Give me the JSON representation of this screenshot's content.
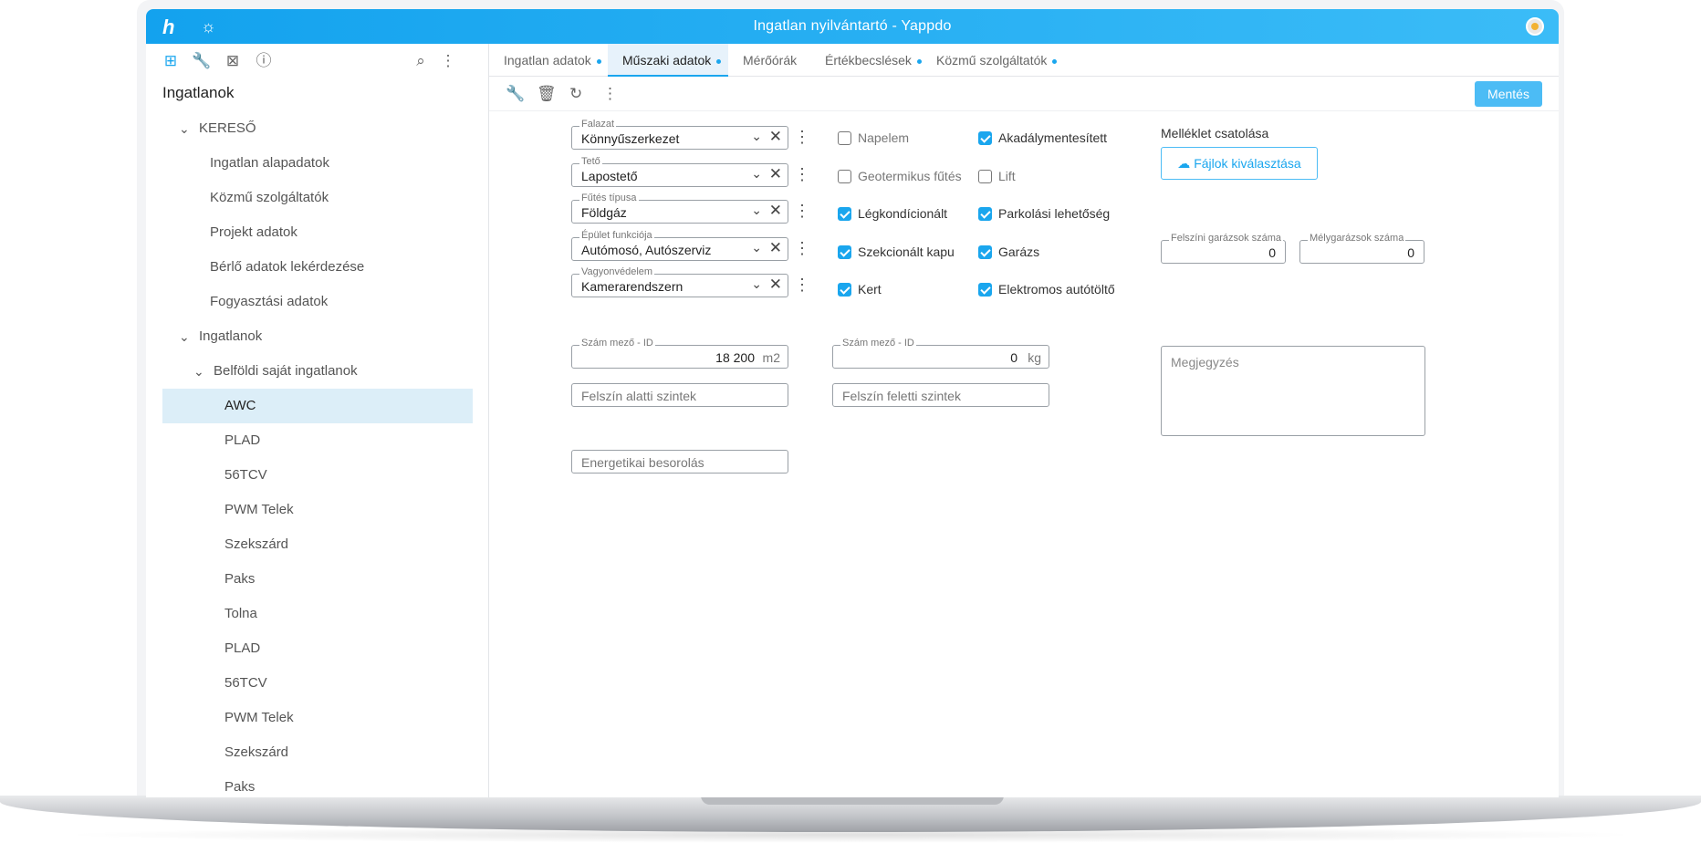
{
  "app": {
    "title": "Ingatlan nyilvántartó - Yappdo",
    "logo": "h"
  },
  "sidebar": {
    "title": "Ingatlanok",
    "tree": [
      {
        "label": "KERESŐ",
        "level": 1,
        "chev": "⌄"
      },
      {
        "label": "Ingatlan alapadatok",
        "level": 2
      },
      {
        "label": "Közmű szolgáltatók",
        "level": 2
      },
      {
        "label": "Projekt adatok",
        "level": 2
      },
      {
        "label": "Bérlő adatok lekérdezése",
        "level": 2
      },
      {
        "label": "Fogyasztási adatok",
        "level": 2
      },
      {
        "label": "Ingatlanok",
        "level": 1,
        "chev": "⌄"
      },
      {
        "label": "Belföldi saját ingatlanok",
        "level": 2,
        "chev": "⌄"
      },
      {
        "label": "AWC",
        "level": 3,
        "selected": true
      },
      {
        "label": "PLAD",
        "level": 3
      },
      {
        "label": "56TCV",
        "level": 3
      },
      {
        "label": "PWM Telek",
        "level": 3
      },
      {
        "label": "Szekszárd",
        "level": 3
      },
      {
        "label": "Paks",
        "level": 3
      },
      {
        "label": "Tolna",
        "level": 3
      },
      {
        "label": "PLAD",
        "level": 3
      },
      {
        "label": "56TCV",
        "level": 3
      },
      {
        "label": "PWM Telek",
        "level": 3
      },
      {
        "label": "Szekszárd",
        "level": 3
      },
      {
        "label": "Paks",
        "level": 3
      }
    ]
  },
  "tabs": [
    {
      "label": "Ingatlan adatok",
      "dot": true,
      "active": false
    },
    {
      "label": "Műszaki adatok",
      "dot": true,
      "active": true
    },
    {
      "label": "Mérőórák",
      "dot": false,
      "active": false
    },
    {
      "label": "Értékbecslések",
      "dot": true,
      "active": false
    },
    {
      "label": "Közmű szolgáltatók",
      "dot": true,
      "active": false
    }
  ],
  "toolbar": {
    "save_label": "Mentés"
  },
  "selects": [
    {
      "label": "Falazat",
      "value": "Könnyűszerkezet"
    },
    {
      "label": "Tető",
      "value": "Lapostető"
    },
    {
      "label": "Fűtés típusa",
      "value": "Földgáz"
    },
    {
      "label": "Épület funkciója",
      "value": "Autómosó, Autószerviz"
    },
    {
      "label": "Vagyonvédelem",
      "value": "Kamerarendszern"
    }
  ],
  "checkboxes_col1": [
    {
      "label": "Napelem",
      "checked": false
    },
    {
      "label": "Geotermikus fűtés",
      "checked": false
    },
    {
      "label": "Légkondícionált",
      "checked": true
    },
    {
      "label": "Szekcionált kapu",
      "checked": true
    },
    {
      "label": "Kert",
      "checked": true
    }
  ],
  "checkboxes_col2": [
    {
      "label": "Akadálymentesített",
      "checked": true
    },
    {
      "label": "Lift",
      "checked": false
    },
    {
      "label": "Parkolási lehetőség",
      "checked": true
    },
    {
      "label": "Garázs",
      "checked": true
    },
    {
      "label": "Elektromos autótöltő",
      "checked": true
    }
  ],
  "attachment": {
    "title": "Melléklet csatolása",
    "button": "Fájlok kiválasztása"
  },
  "garages": {
    "surface": {
      "label": "Felszíni garázsok száma",
      "value": "0"
    },
    "underground": {
      "label": "Mélygarázsok száma",
      "value": "0"
    }
  },
  "numbers": {
    "area": {
      "label": "Szám mező - ID",
      "value": "18 200",
      "unit": "m2"
    },
    "weight": {
      "label": "Szám mező - ID",
      "value": "0",
      "unit": "kg"
    }
  },
  "inputs": {
    "below": {
      "placeholder": "Felszín alatti szintek"
    },
    "above": {
      "placeholder": "Felszín feletti szintek"
    },
    "energy": {
      "placeholder": "Energetikai besorolás"
    }
  },
  "note": {
    "placeholder": "Megjegyzés"
  },
  "colors": {
    "accent": "#1aa6ee",
    "topbar": "#13a2ee",
    "selected": "#dceef8",
    "save": "#4cbcf5"
  }
}
